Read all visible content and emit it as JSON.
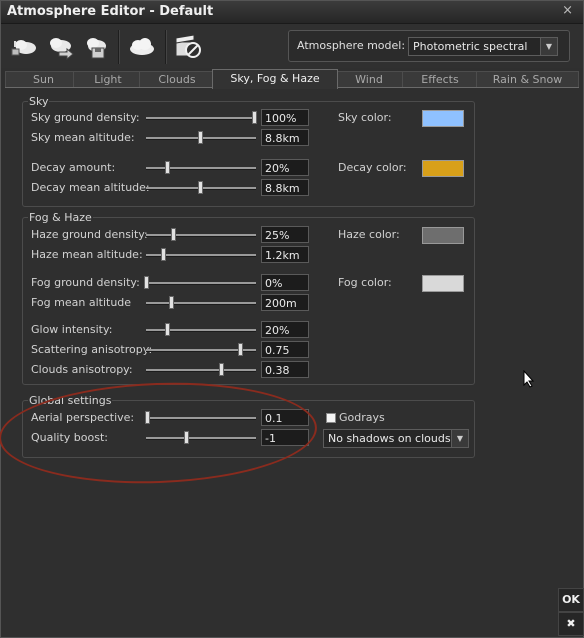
{
  "window": {
    "title": "Atmosphere Editor - Default",
    "close_label": "×"
  },
  "toolbar": {
    "icons": [
      "cloud-light-icon",
      "cloud-arrow-icon",
      "cloud-save-icon",
      "cloud-icon",
      "clapper-noedit-icon"
    ],
    "model_label": "Atmosphere model:",
    "model_value": "Photometric spectral"
  },
  "tabs": [
    "Sun",
    "Light",
    "Clouds",
    "Sky, Fog & Haze",
    "Wind",
    "Effects",
    "Rain & Snow"
  ],
  "active_tab": "Sky, Fog & Haze",
  "sky": {
    "title": "Sky",
    "ground_density": {
      "label": "Sky ground density:",
      "value": "100%",
      "slider": 1.0
    },
    "mean_altitude": {
      "label": "Sky mean altitude:",
      "value": "8.8km",
      "slider": 0.5
    },
    "decay_amount": {
      "label": "Decay amount:",
      "value": "20%",
      "slider": 0.19
    },
    "decay_altitude": {
      "label": "Decay mean altitude:",
      "value": "8.8km",
      "slider": 0.5
    },
    "sky_color": {
      "label": "Sky color:",
      "color": "#8fc1ff"
    },
    "decay_color": {
      "label": "Decay color:",
      "color": "#d8a01a"
    }
  },
  "fog": {
    "title": "Fog & Haze",
    "haze_density": {
      "label": "Haze ground density:",
      "value": "25%",
      "slider": 0.25
    },
    "haze_altitude": {
      "label": "Haze mean altitude:",
      "value": "1.2km",
      "slider": 0.16
    },
    "fog_density": {
      "label": "Fog ground density:",
      "value": "0%",
      "slider": 0.0
    },
    "fog_altitude": {
      "label": "Fog mean altitude",
      "value": "200m",
      "slider": 0.23
    },
    "glow": {
      "label": "Glow intensity:",
      "value": "20%",
      "slider": 0.19
    },
    "scattering": {
      "label": "Scattering anisotropy:",
      "value": "0.75",
      "slider": 0.87
    },
    "clouds_aniso": {
      "label": "Clouds anisotropy:",
      "value": "0.38",
      "slider": 0.69
    },
    "haze_color": {
      "label": "Haze color:",
      "color": "#6e6e6e"
    },
    "fog_color": {
      "label": "Fog color:",
      "color": "#d9d9d9"
    }
  },
  "global": {
    "title": "Global settings",
    "aerial": {
      "label": "Aerial perspective:",
      "value": "0.1",
      "slider": 0.01
    },
    "quality": {
      "label": "Quality boost:",
      "value": "-1",
      "slider": 0.37
    },
    "godrays_label": "Godrays",
    "godrays_checked": false,
    "shadows_value": "No shadows on clouds"
  },
  "buttons": {
    "ok": "OK",
    "cancel": "✖"
  }
}
